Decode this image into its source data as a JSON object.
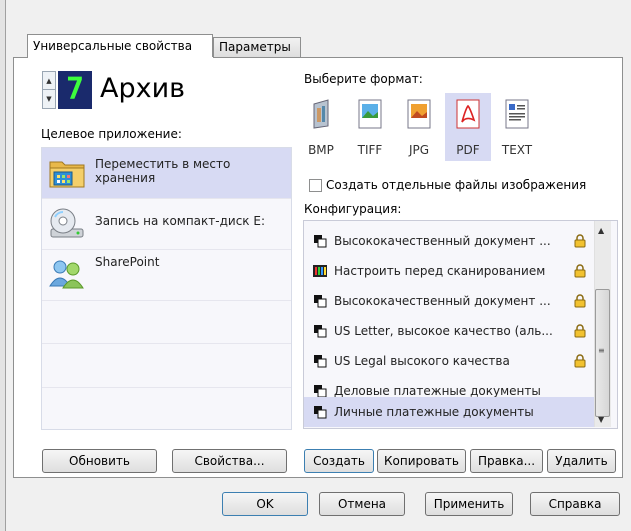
{
  "tabs": [
    "Универсальные свойства",
    "Параметры"
  ],
  "button_number": "7",
  "button_name": "Архив",
  "target_app_label": "Целевое приложение:",
  "apps": [
    {
      "label": "Переместить в место\nхранения",
      "icon": "folder-move-icon",
      "selected": true
    },
    {
      "label": "Запись на компакт-диск  E:",
      "icon": "cd-drive-icon",
      "selected": false
    },
    {
      "label": "SharePoint",
      "icon": "sharepoint-icon",
      "selected": false
    }
  ],
  "refresh_button": "Обновить",
  "properties_button": "Свойства...",
  "format_label": "Выберите формат:",
  "formats": [
    {
      "label": "BMP",
      "icon": "bmp-file-icon",
      "selected": false
    },
    {
      "label": "TIFF",
      "icon": "tiff-file-icon",
      "selected": false
    },
    {
      "label": "JPG",
      "icon": "jpg-file-icon",
      "selected": false
    },
    {
      "label": "PDF",
      "icon": "pdf-file-icon",
      "selected": true
    },
    {
      "label": "TEXT",
      "icon": "text-file-icon",
      "selected": false
    }
  ],
  "separate_files_checkbox": {
    "label": "Создать отдельные файлы изображения",
    "checked": false
  },
  "config_label": "Конфигурация:",
  "configs": [
    {
      "label": "Высококачественный документ ...",
      "locked": true,
      "icon": "config-icon"
    },
    {
      "label": "Настроить перед сканированием",
      "locked": true,
      "icon": "configure-before-scan-icon"
    },
    {
      "label": "Высококачественный документ ...",
      "locked": true,
      "icon": "config-icon"
    },
    {
      "label": "US Letter, высокое качество (аль...",
      "locked": true,
      "icon": "config-icon"
    },
    {
      "label": "US Legal высокого качества",
      "locked": true,
      "icon": "config-icon"
    },
    {
      "label": "Деловые платежные документы",
      "locked": false,
      "icon": "config-icon"
    },
    {
      "label": "Личные платежные документы",
      "locked": false,
      "icon": "config-icon",
      "selected": true
    }
  ],
  "config_buttons": {
    "create": "Создать",
    "copy": "Копировать",
    "edit": "Правка...",
    "delete": "Удалить"
  },
  "dialog_buttons": {
    "ok": "OK",
    "cancel": "Отмена",
    "apply": "Применить",
    "help": "Справка"
  },
  "colors": {
    "selection": "#d7daf3",
    "lcd_bg": "#1a2a6c",
    "lcd_digit": "#3dff3d"
  }
}
